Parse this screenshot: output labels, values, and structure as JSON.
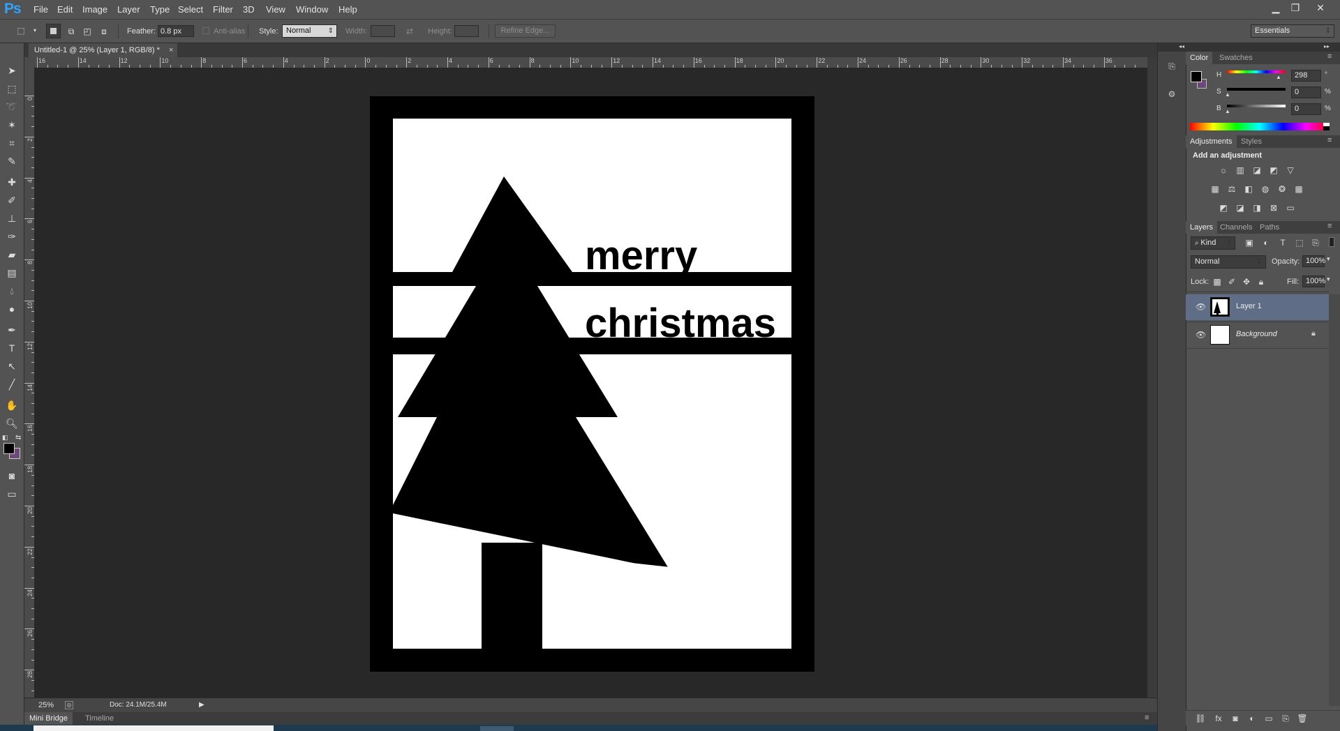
{
  "app": {
    "logo": "Ps"
  },
  "menu": [
    "File",
    "Edit",
    "Image",
    "Layer",
    "Type",
    "Select",
    "Filter",
    "3D",
    "View",
    "Window",
    "Help"
  ],
  "window_controls": {
    "minimize": "▁",
    "restore": "❐",
    "close": "✕"
  },
  "options": {
    "feather_label": "Feather:",
    "feather_value": "0.8 px",
    "antialias_label": "Anti-alias",
    "style_label": "Style:",
    "style_value": "Normal",
    "width_label": "Width:",
    "height_label": "Height:",
    "refine_edge": "Refine Edge...",
    "workspace": "Essentials"
  },
  "document": {
    "tab_title": "Untitled-1 @ 25% (Layer 1, RGB/8) *",
    "close": "×",
    "art": {
      "text_line1": "merry",
      "text_line2": "christmas"
    }
  },
  "ruler": {
    "h_labels": [
      "16",
      "14",
      "12",
      "10",
      "8",
      "6",
      "4",
      "2",
      "0",
      "2",
      "4",
      "6",
      "8",
      "10",
      "12",
      "14",
      "16",
      "18",
      "20",
      "22",
      "24",
      "26",
      "28",
      "30",
      "32",
      "34",
      "36"
    ],
    "v_labels": [
      "0",
      "2",
      "4",
      "6",
      "8",
      "10",
      "12",
      "14",
      "16",
      "18",
      "20",
      "22",
      "24",
      "26",
      "28"
    ]
  },
  "status": {
    "zoom": "25%",
    "doc_info": "Doc: 24.1M/25.4M"
  },
  "bottom_tabs": {
    "mini_bridge": "Mini Bridge",
    "timeline": "Timeline"
  },
  "panels": {
    "color": {
      "tabs": [
        "Color",
        "Swatches"
      ],
      "h_label": "H",
      "h_value": "298",
      "h_unit": "°",
      "s_label": "S",
      "s_value": "0",
      "s_unit": "%",
      "b_label": "B",
      "b_value": "0",
      "b_unit": "%",
      "foreground": "#000000",
      "background": "#6b4a7a"
    },
    "adjustments": {
      "tabs": [
        "Adjustments",
        "Styles"
      ],
      "heading": "Add an adjustment",
      "icons_row1": [
        "brightness-contrast-icon",
        "levels-icon",
        "curves-icon",
        "exposure-icon",
        "vibrance-icon"
      ],
      "icons_row2": [
        "hue-saturation-icon",
        "color-balance-icon",
        "black-white-icon",
        "photo-filter-icon",
        "channel-mixer-icon",
        "color-lookup-icon"
      ],
      "icons_row3": [
        "invert-icon",
        "posterize-icon",
        "threshold-icon",
        "selective-color-icon",
        "gradient-map-icon"
      ]
    },
    "layers": {
      "tabs": [
        "Layers",
        "Channels",
        "Paths"
      ],
      "kind_label": "Kind",
      "blend_mode": "Normal",
      "opacity_label": "Opacity:",
      "opacity_value": "100%",
      "lock_label": "Lock:",
      "fill_label": "Fill:",
      "fill_value": "100%",
      "items": [
        {
          "name": "Layer 1",
          "selected": true
        },
        {
          "name": "Background",
          "selected": false,
          "locked": true
        }
      ]
    }
  },
  "colors": {
    "accent_blue": "#2fa3ff",
    "selected_layer": "#5f6e86"
  }
}
